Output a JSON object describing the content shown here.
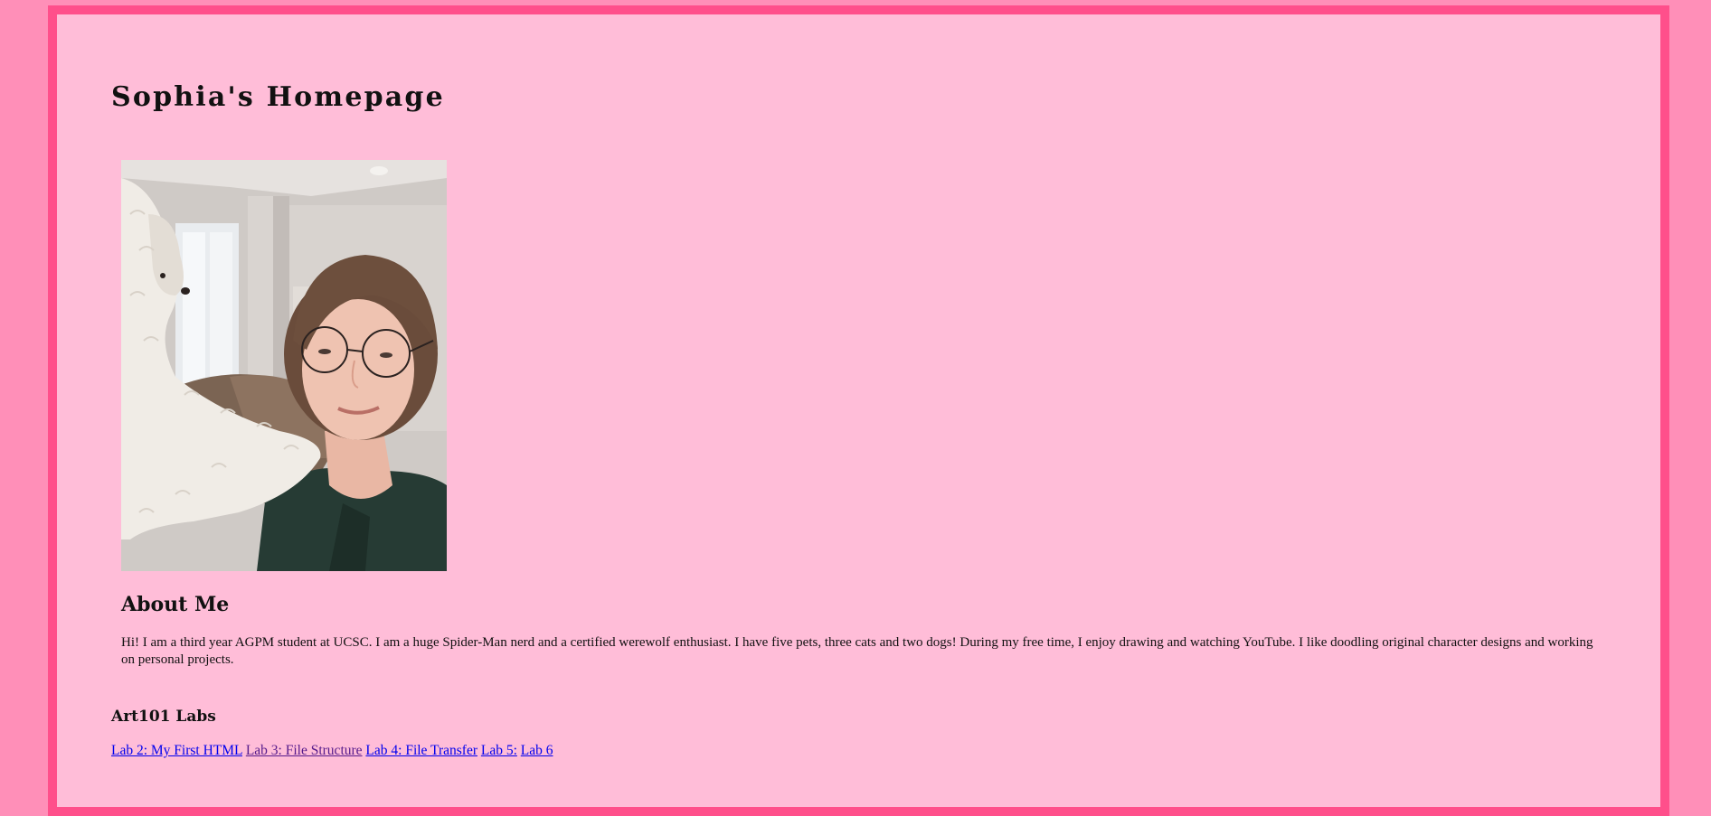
{
  "page": {
    "title": "Sophia's Homepage"
  },
  "photo": {
    "alt": "Selfie of Sophia with glasses and a fluffy white dog"
  },
  "about": {
    "heading": "About Me",
    "text": "Hi! I am a third year AGPM student at UCSC. I am a huge Spider-Man nerd and a certified werewolf enthusiast. I have five pets, three cats and two dogs! During my free time, I enjoy drawing and watching YouTube. I like doodling original character designs and working on personal projects."
  },
  "labs": {
    "heading": "Art101 Labs",
    "links": [
      {
        "label": "Lab 2: My First HTML",
        "visited": false
      },
      {
        "label": "Lab 3: File Structure",
        "visited": true
      },
      {
        "label": "Lab 4: File Transfer",
        "visited": false
      },
      {
        "label": "Lab 5:",
        "visited": false
      },
      {
        "label": "Lab 6",
        "visited": false
      }
    ]
  },
  "colors": {
    "outer_background": "#ff8fb8",
    "frame_border": "#ff4f8b",
    "inner_background": "#ffbdd8",
    "link": "#0000ee",
    "visited_link": "#551a8b"
  }
}
